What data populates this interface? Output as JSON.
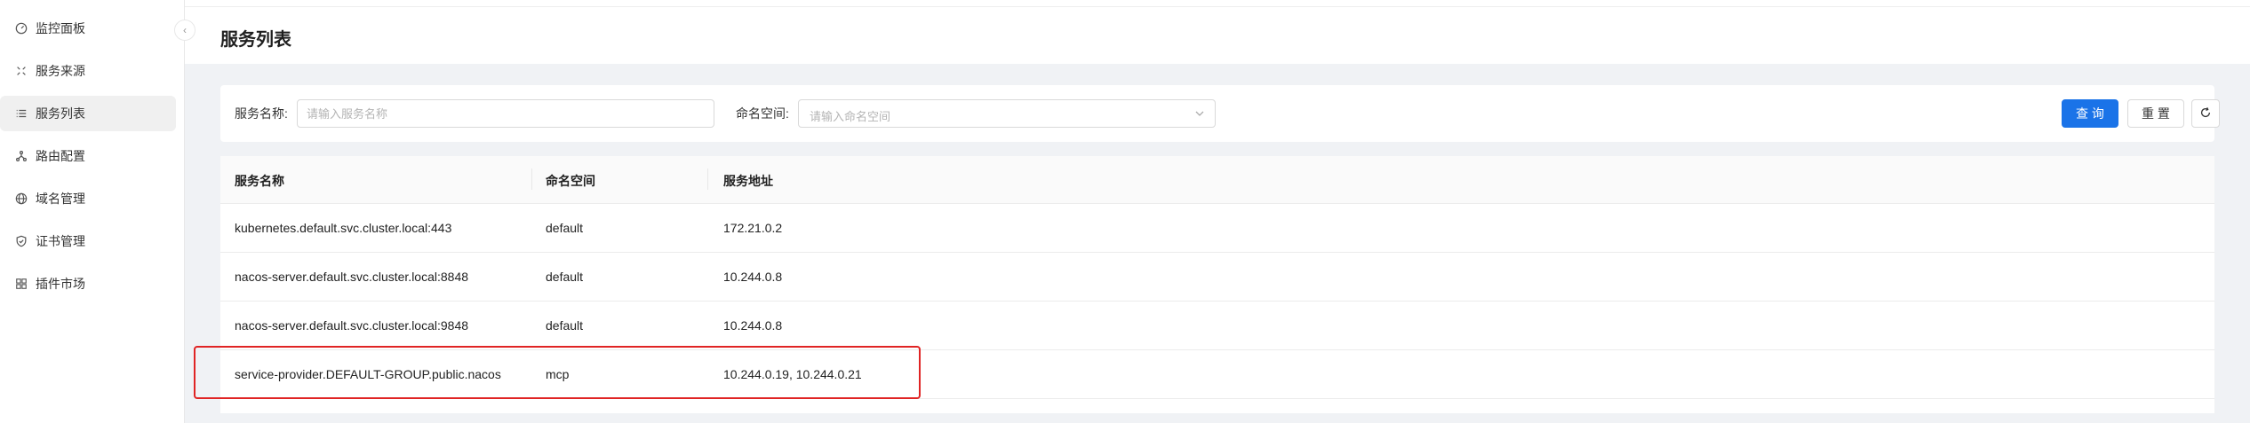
{
  "sidebar": {
    "collapse_icon": "chevron-left-icon",
    "items": [
      {
        "label": "监控面板",
        "icon": "dashboard-icon"
      },
      {
        "label": "服务来源",
        "icon": "expand-arrows-icon"
      },
      {
        "label": "服务列表",
        "icon": "list-icon",
        "active": true
      },
      {
        "label": "路由配置",
        "icon": "route-icon"
      },
      {
        "label": "域名管理",
        "icon": "globe-icon"
      },
      {
        "label": "证书管理",
        "icon": "shield-icon"
      },
      {
        "label": "插件市场",
        "icon": "plugin-icon"
      }
    ]
  },
  "header": {
    "title": "服务列表"
  },
  "filter": {
    "service_name_label": "服务名称:",
    "service_name_placeholder": "请输入服务名称",
    "namespace_label": "命名空间:",
    "namespace_placeholder": "请输入命名空间",
    "query_label": "查 询",
    "reset_label": "重 置",
    "refresh_icon": "refresh-icon"
  },
  "table": {
    "columns": [
      "服务名称",
      "命名空间",
      "服务地址"
    ],
    "rows": [
      {
        "name": "kubernetes.default.svc.cluster.local:443",
        "namespace": "default",
        "address": "172.21.0.2"
      },
      {
        "name": "nacos-server.default.svc.cluster.local:8848",
        "namespace": "default",
        "address": "10.244.0.8"
      },
      {
        "name": "nacos-server.default.svc.cluster.local:9848",
        "namespace": "default",
        "address": "10.244.0.8"
      },
      {
        "name": "service-provider.DEFAULT-GROUP.public.nacos",
        "namespace": "mcp",
        "address": "10.244.0.19, 10.244.0.21"
      }
    ]
  },
  "colors": {
    "primary": "#1a73e8",
    "highlight": "#e02424"
  }
}
